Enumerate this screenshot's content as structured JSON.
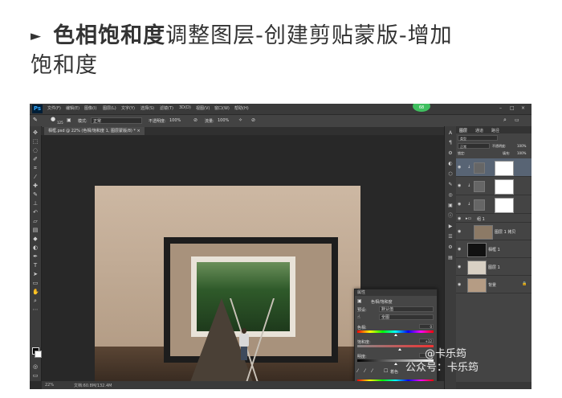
{
  "heading": {
    "bullet": "►",
    "bold": "色相饱和度",
    "rest": "调整图层-创建剪贴蒙版-增加",
    "line2": "饱和度"
  },
  "ps": {
    "logo": "Ps",
    "menu": [
      "文件(F)",
      "编辑(E)",
      "图像(I)",
      "图层(L)",
      "文字(Y)",
      "选择(S)",
      "滤镜(T)",
      "3D(D)",
      "视图(V)",
      "窗口(W)",
      "帮助(H)"
    ],
    "badge": "68",
    "options": {
      "size": "125",
      "mode_label": "模式:",
      "mode_value": "正常",
      "opacity_label": "不透明度:",
      "opacity_value": "100%",
      "flow_label": "流量:",
      "flow_value": "100%"
    },
    "doc_tab": "相框.psd @ 22% (色相/饱和度 1, 图层蒙版/8) * ×",
    "status": {
      "zoom": "22%",
      "doc": "文档:60.8M/132.4M"
    },
    "hue_sat": {
      "panel_title": "属性",
      "header": "色相/饱和度",
      "preset_label": "预设:",
      "preset_value": "默认值",
      "channel_value": "全图",
      "hue_label": "色相:",
      "hue_value": "0",
      "sat_label": "饱和度:",
      "sat_value": "+12",
      "lum_label": "明度:",
      "lum_value": "0",
      "colorize_label": "着色",
      "hue_fraction": 0.5,
      "sat_fraction": 0.56,
      "lum_fraction": 0.5
    },
    "layers": {
      "tabs": [
        "图层",
        "通道",
        "路径"
      ],
      "kind": "类型",
      "blend": "正常",
      "opacity_label": "不透明度:",
      "opacity_value": "100%",
      "lock_label": "锁定:",
      "fill_label": "填充:",
      "fill_value": "100%",
      "group_name": "组 1",
      "rows": [
        {
          "name": "图层 1 拷贝"
        },
        {
          "name": "相框 1"
        },
        {
          "name": "图层 1"
        },
        {
          "name": "背景"
        }
      ]
    }
  },
  "watermark": {
    "line1": "@卡乐筠",
    "line2": "公众号：卡乐筠"
  }
}
